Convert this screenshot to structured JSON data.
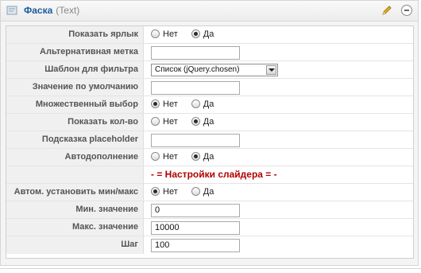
{
  "header": {
    "title": "Фаска",
    "type": "(Text)",
    "edit_icon": "pencil-icon",
    "close_icon": "delete-icon",
    "accent_color": "#1a5c9e"
  },
  "rows": {
    "show_label": {
      "label": "Показать ярлык",
      "opt_no": "Нет",
      "opt_yes": "Да",
      "selected": "Да"
    },
    "alt_label": {
      "label": "Альтернативная метка",
      "value": ""
    },
    "filter_template": {
      "label": "Шаблон для фильтра",
      "selected": "Список (jQuery.chosen)"
    },
    "default_value": {
      "label": "Значение по умолчанию",
      "value": ""
    },
    "multiple": {
      "label": "Множественный выбор",
      "opt_no": "Нет",
      "opt_yes": "Да",
      "selected": "Нет"
    },
    "show_count": {
      "label": "Показать кол-во",
      "opt_no": "Нет",
      "opt_yes": "Да",
      "selected": "Да"
    },
    "placeholder": {
      "label": "Подсказка placeholder",
      "value": ""
    },
    "autocomplete": {
      "label": "Автодополнение",
      "opt_no": "Нет",
      "opt_yes": "Да",
      "selected": "Да"
    },
    "slider_section": {
      "label": "- = Настройки слайдера = -",
      "color": "#b30000"
    },
    "auto_minmax": {
      "label": "Автом. установить мин/макс",
      "opt_no": "Нет",
      "opt_yes": "Да",
      "selected": "Нет"
    },
    "min_value": {
      "label": "Мин. значение",
      "value": "0"
    },
    "max_value": {
      "label": "Макс. значение",
      "value": "10000"
    },
    "step": {
      "label": "Шаг",
      "value": "100"
    }
  }
}
